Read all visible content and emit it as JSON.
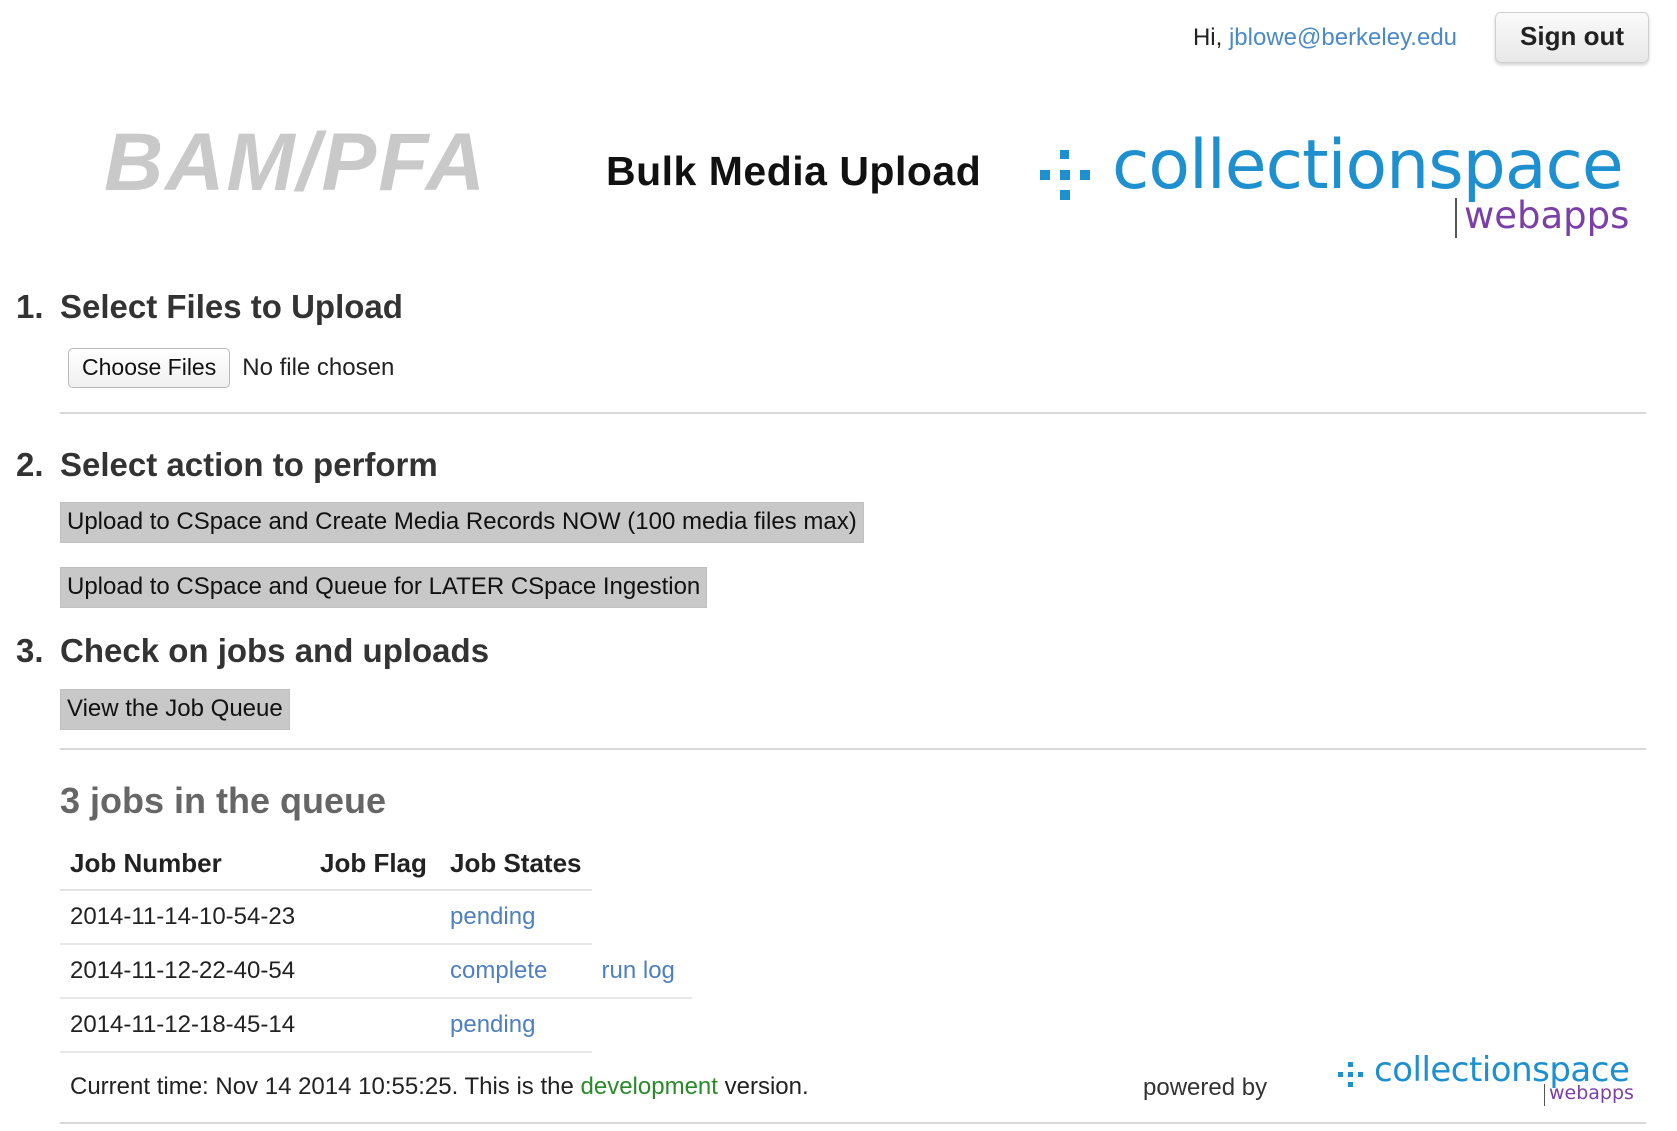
{
  "header": {
    "greeting_prefix": "Hi,",
    "user_email": "jblowe@berkeley.edu",
    "sign_out_label": "Sign out",
    "institution_logo_text": "BAM/PFA",
    "page_title": "Bulk Media Upload",
    "cs_logo_word": "collectionspace",
    "cs_logo_sub": "webapps"
  },
  "step1": {
    "number": "1.",
    "heading": "Select Files to Upload",
    "choose_files_label": "Choose Files",
    "no_file_text": "No file chosen"
  },
  "step2": {
    "number": "2.",
    "heading": "Select action to perform",
    "action_now_label": "Upload to CSpace and Create Media Records NOW (100 media files max)",
    "action_later_label": "Upload to CSpace and Queue for LATER CSpace Ingestion"
  },
  "step3": {
    "number": "3.",
    "heading": "Check on jobs and uploads",
    "view_queue_label": "View the Job Queue"
  },
  "queue": {
    "title": "3 jobs in the queue",
    "columns": [
      "Job Number",
      "Job Flag",
      "Job States"
    ],
    "rows": [
      {
        "job_number": "2014-11-14-10-54-23",
        "job_flag": "",
        "job_state": "pending",
        "extra_link": ""
      },
      {
        "job_number": "2014-11-12-22-40-54",
        "job_flag": "",
        "job_state": "complete",
        "extra_link": "run log"
      },
      {
        "job_number": "2014-11-12-18-45-14",
        "job_flag": "",
        "job_state": "pending",
        "extra_link": ""
      }
    ]
  },
  "footer": {
    "time_prefix": "Current time: Nov 14 2014 10:55:25. This is the",
    "environment": "development",
    "time_suffix": "version.",
    "powered_by": "powered by"
  },
  "colors": {
    "link_blue": "#4e7fbf",
    "cs_blue": "#1e8fcf",
    "cs_purple": "#7b3fa8",
    "env_green": "#2a8a2a",
    "action_button_gray": "#c8c8c8"
  }
}
